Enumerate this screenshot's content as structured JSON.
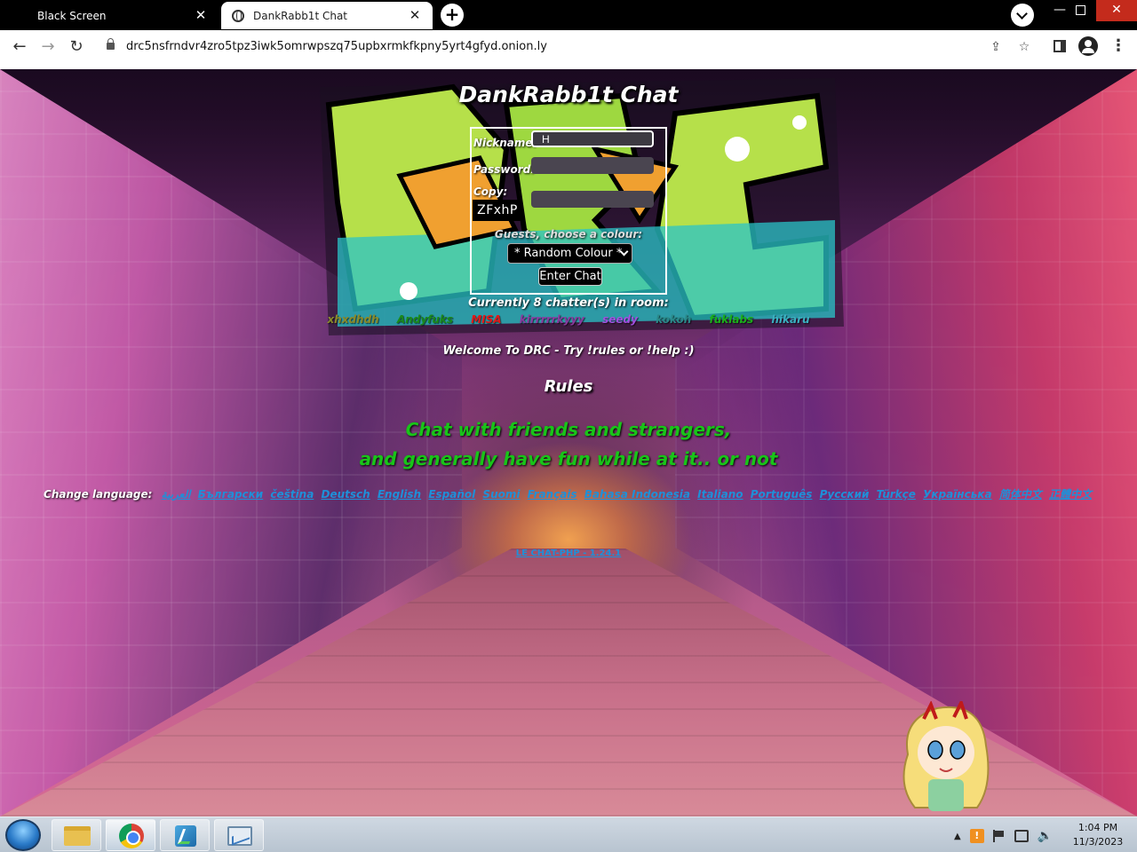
{
  "browser": {
    "tabs": [
      {
        "title": "Black Screen",
        "active": false
      },
      {
        "title": "DankRabb1t Chat",
        "active": true
      }
    ],
    "url": "drc5nsfrndvr4zro5tpz3iwk5omrwpszq75upbxrmkfkpny5yrt4gfyd.onion.ly"
  },
  "chat": {
    "title": "DankRabb1t Chat",
    "login": {
      "nickname_label": "Nickname:",
      "nickname_value": "H",
      "password_label": "Password:",
      "copy_label": "Copy:",
      "captcha": "ZFxhP",
      "guest_label": "Guests, choose a colour:",
      "colour_selected": "* Random Colour *",
      "enter_button": "Enter Chat"
    },
    "chatters_count": "Currently 8 chatter(s) in room:",
    "chatters": [
      {
        "name": "xhxdhdh",
        "color": "#8a8a2a"
      },
      {
        "name": "Andyfuks",
        "color": "#1a8a1a"
      },
      {
        "name": "MISA",
        "color": "#e01a1a"
      },
      {
        "name": "kirrrrrkyyy",
        "color": "#8a3aa0"
      },
      {
        "name": "seedy",
        "color": "#a050e0"
      },
      {
        "name": "kokoh",
        "color": "#2a8a8a"
      },
      {
        "name": "fuklabs",
        "color": "#1ab01a"
      },
      {
        "name": "hikaru",
        "color": "#3ab0c0"
      }
    ],
    "welcome": "Welcome To DRC - Try !rules or !help :)",
    "rules_heading": "Rules",
    "rules_line1": "Chat with friends and strangers,",
    "rules_line2": "and generally have fun while at it.. or not",
    "language_label": "Change language:",
    "languages": [
      "العربية",
      "Български",
      "čeština",
      "Deutsch",
      "English",
      "Español",
      "Suomi",
      "Français",
      "Bahasa Indonesia",
      "Italiano",
      "Português",
      "Русский",
      "Türkçe",
      "Українська",
      "简体中文",
      "正體中文"
    ],
    "version": "LE CHAT-PHP - 1.24.1"
  },
  "taskbar": {
    "time": "1:04 PM",
    "date": "11/3/2023"
  },
  "colors": {
    "rules_green": "#19c419",
    "link_blue": "#1e90d8"
  }
}
